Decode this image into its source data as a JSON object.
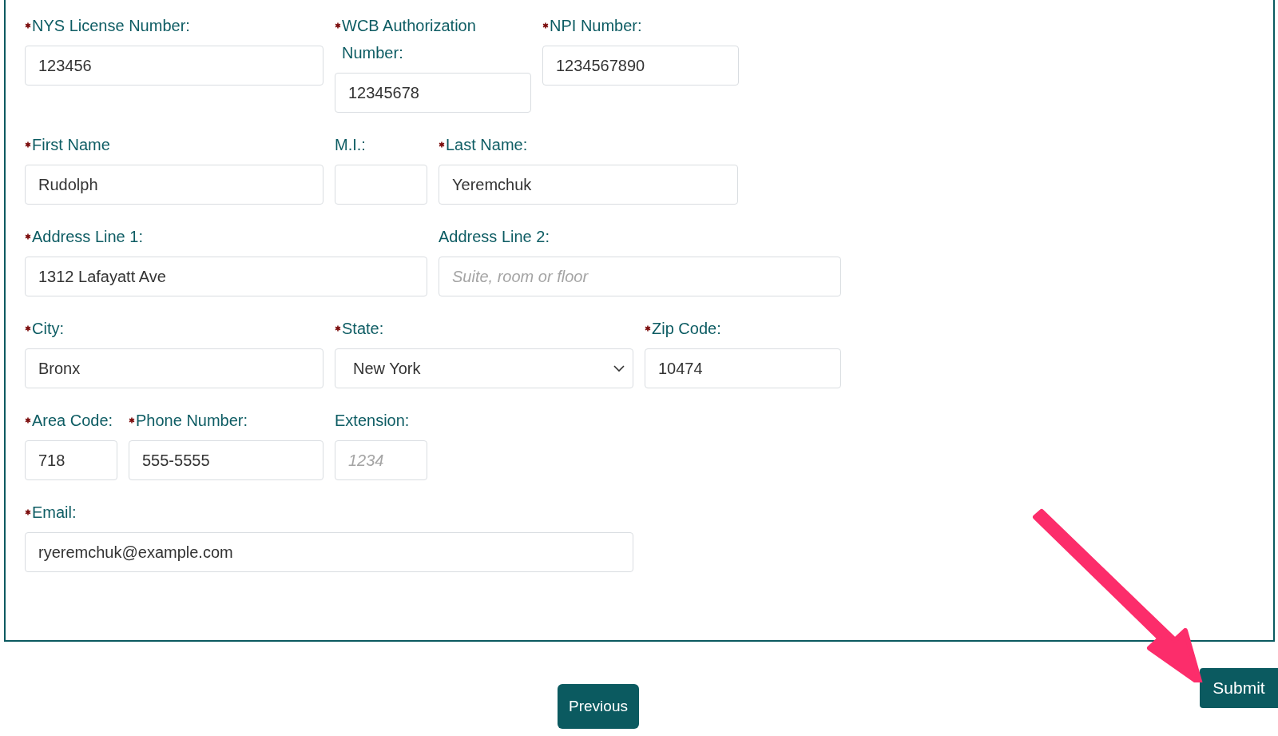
{
  "form": {
    "rows": [
      {
        "fields": [
          {
            "label": "NYS License Number:",
            "required": true,
            "kind": "text",
            "value": "123456"
          },
          {
            "label": "WCB Authorization Number:",
            "required": true,
            "kind": "text",
            "value": "12345678"
          },
          {
            "label": "NPI Number:",
            "required": true,
            "kind": "text",
            "value": "1234567890"
          }
        ]
      },
      {
        "fields": [
          {
            "label": "First Name",
            "required": true,
            "kind": "text",
            "value": "Rudolph"
          },
          {
            "label": "M.I.:",
            "required": false,
            "kind": "text"
          },
          {
            "label": "Last Name:",
            "required": true,
            "kind": "text",
            "value": "Yeremchuk"
          }
        ]
      },
      {
        "fields": [
          {
            "label": "Address Line 1:",
            "required": true,
            "kind": "text",
            "value": "1312 Lafayatt Ave"
          },
          {
            "label": "Address Line 2:",
            "required": false,
            "kind": "text",
            "placeholder": "Suite, room or floor"
          }
        ]
      },
      {
        "fields": [
          {
            "label": "City:",
            "required": true,
            "kind": "text",
            "value": "Bronx"
          },
          {
            "label": "State:",
            "required": true,
            "kind": "select",
            "value": "New York"
          },
          {
            "label": "Zip Code:",
            "required": true,
            "kind": "text",
            "value": "10474"
          }
        ]
      },
      {
        "fields": [
          {
            "label": "Area Code:",
            "required": true,
            "kind": "text",
            "value": "718"
          },
          {
            "label": "Phone Number:",
            "required": true,
            "kind": "text",
            "value": "555-5555"
          },
          {
            "label": "Extension:",
            "required": false,
            "kind": "text",
            "placeholder": "1234"
          }
        ]
      },
      {
        "fields": [
          {
            "label": "Email:",
            "required": true,
            "kind": "text",
            "value": "ryeremchuk@example.com"
          }
        ]
      }
    ]
  },
  "buttons": [
    {
      "label": "Previous",
      "kind": "previous"
    },
    {
      "label": "Submit",
      "kind": "submit"
    }
  ]
}
